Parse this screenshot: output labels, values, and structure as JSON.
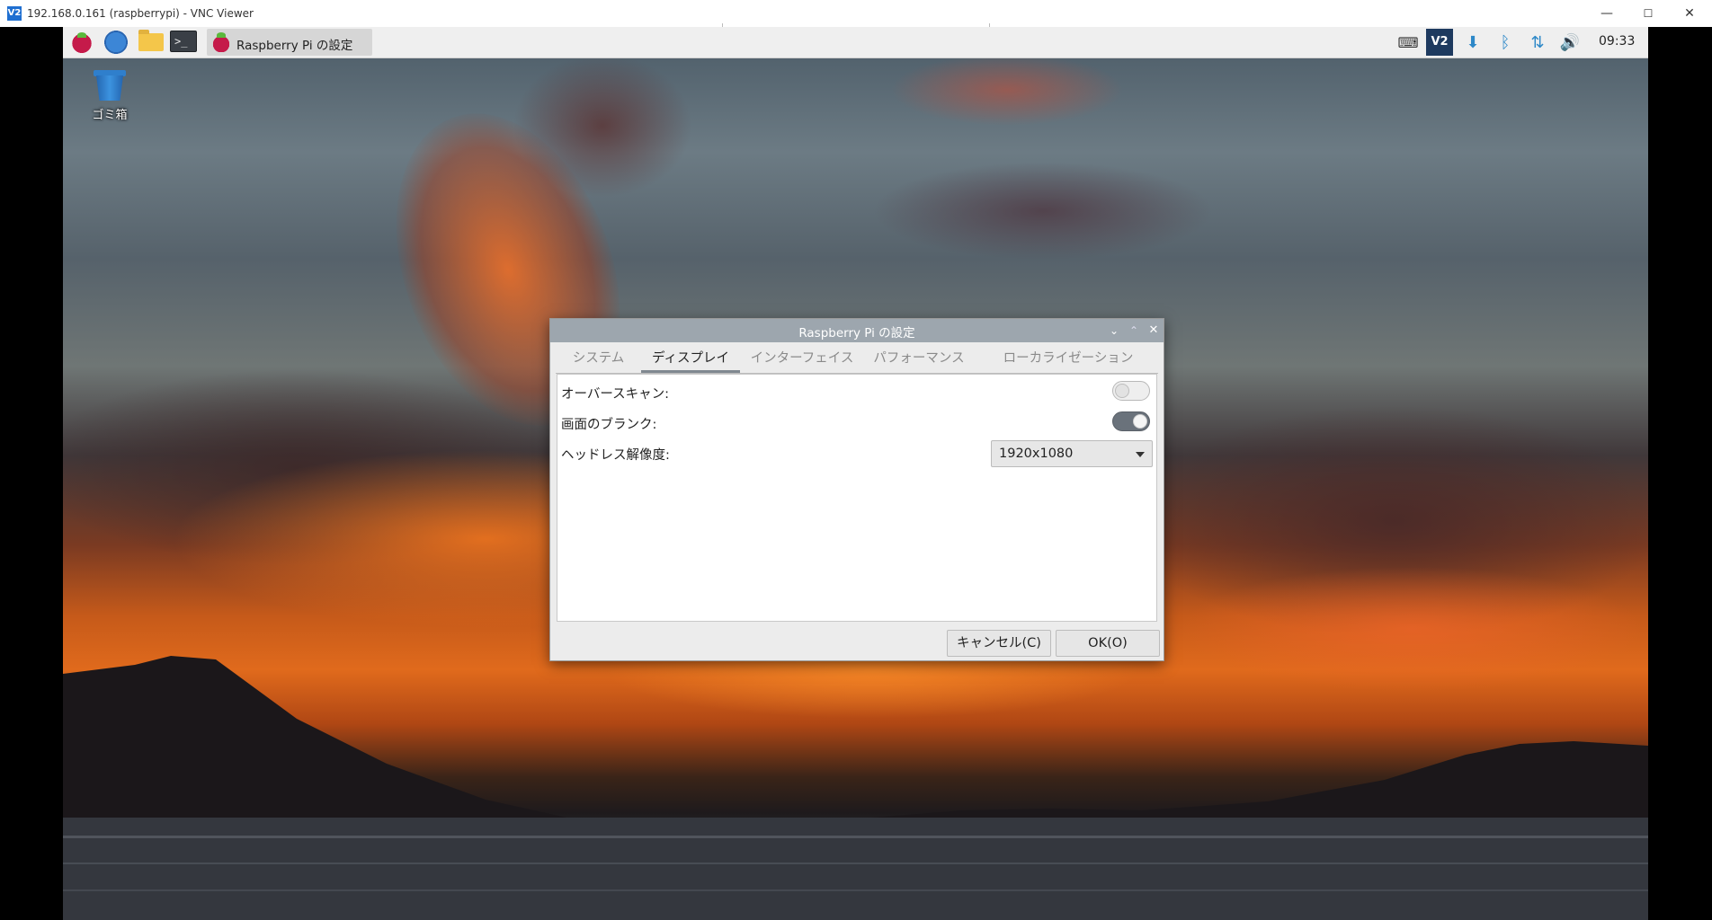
{
  "window": {
    "title": "192.168.0.161 (raspberrypi) - VNC Viewer",
    "app_icon": "vnc-logo",
    "controls": {
      "minimize": "—",
      "maximize": "☐",
      "close": "✕"
    }
  },
  "taskbar": {
    "launchers": [
      "raspberry-menu-icon",
      "browser-icon",
      "file-manager-icon",
      "terminal-icon"
    ],
    "terminal_glyph": ">_",
    "task_label": "Raspberry Pi の設定",
    "tray": [
      "keyboard-icon",
      "vnc-icon",
      "update-icon",
      "bluetooth-icon",
      "network-icon",
      "volume-icon"
    ],
    "clock": "09:33"
  },
  "desktop": {
    "trash_label": "ゴミ箱"
  },
  "dialog": {
    "title": "Raspberry Pi の設定",
    "tabs": [
      "システム",
      "ディスプレイ",
      "インターフェイス",
      "パフォーマンス",
      "ローカライゼーション"
    ],
    "active_tab": "ディスプレイ",
    "rows": {
      "overscan": {
        "label": "オーバースキャン:",
        "enabled": false
      },
      "blanking": {
        "label": "画面のブランク:",
        "enabled": true
      },
      "headless": {
        "label": "ヘッドレス解像度:",
        "value": "1920x1080"
      }
    },
    "buttons": {
      "cancel": "キャンセル(C)",
      "ok": "OK(O)"
    }
  }
}
